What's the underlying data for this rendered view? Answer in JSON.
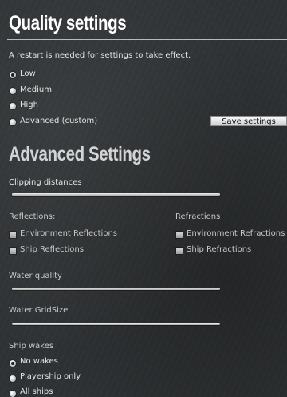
{
  "quality": {
    "title": "Quality settings",
    "restart_note": "A restart is needed for settings to take effect.",
    "options": [
      "Low",
      "Medium",
      "High",
      "Advanced (custom)"
    ],
    "selected": "Low",
    "save_label": "Save settings"
  },
  "advanced": {
    "title": "Advanced Settings",
    "clipping_label": "Clipping distances",
    "reflections_header": "Reflections:",
    "refractions_header": "Refractions",
    "env_reflections": "Environment Reflections",
    "ship_reflections": "Ship Reflections",
    "env_refractions": "Environment Refractions",
    "ship_refractions": "Ship Refractions",
    "water_quality_label": "Water quality",
    "water_gridsize_label": "Water GridSize",
    "ship_wakes_label": "Ship wakes",
    "wake_options": [
      "No wakes",
      "Playership only",
      "All ships"
    ],
    "wake_selected": "No wakes"
  },
  "colors": {
    "background": "#2f3234",
    "text": "#e6e6e6",
    "heading": "#ffffff"
  }
}
